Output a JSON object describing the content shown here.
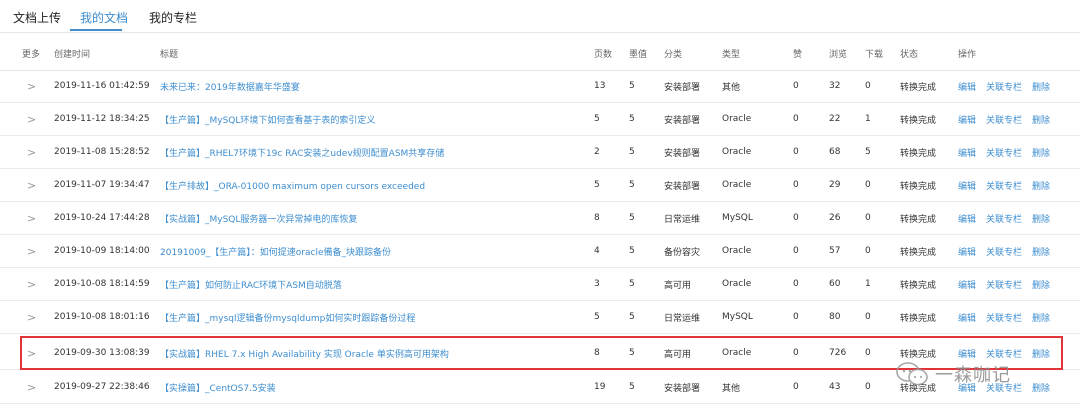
{
  "tabs": [
    {
      "label": "文档上传"
    },
    {
      "label": "我的文档"
    },
    {
      "label": "我的专栏"
    }
  ],
  "table": {
    "headers": {
      "more": "更多",
      "time": "创建时间",
      "title": "标题",
      "pages": "页数",
      "coins": "墨值",
      "category": "分类",
      "type": "类型",
      "likes": "赞",
      "views": "浏览",
      "downloads": "下载",
      "status": "状态",
      "ops": "操作"
    },
    "rows": [
      {
        "time": "2019-11-16 01:42:59",
        "title": "未来已来：2019年数据嘉年华盛宴",
        "pages": "13",
        "coins": "5",
        "category": "安装部署",
        "type": "其他",
        "likes": "0",
        "views": "32",
        "downloads": "0",
        "status": "转换完成"
      },
      {
        "time": "2019-11-12 18:34:25",
        "title": "【生产篇】_MySQL环境下如何查看基于表的索引定义",
        "pages": "5",
        "coins": "5",
        "category": "安装部署",
        "type": "Oracle",
        "likes": "0",
        "views": "22",
        "downloads": "1",
        "status": "转换完成"
      },
      {
        "time": "2019-11-08 15:28:52",
        "title": "【生产篇】_RHEL7环境下19c RAC安装之udev规则配置ASM共享存储",
        "pages": "2",
        "coins": "5",
        "category": "安装部署",
        "type": "Oracle",
        "likes": "0",
        "views": "68",
        "downloads": "5",
        "status": "转换完成"
      },
      {
        "time": "2019-11-07 19:34:47",
        "title": "【生产排故】_ORA-01000 maximum open cursors exceeded",
        "pages": "5",
        "coins": "5",
        "category": "安装部署",
        "type": "Oracle",
        "likes": "0",
        "views": "29",
        "downloads": "0",
        "status": "转换完成"
      },
      {
        "time": "2019-10-24 17:44:28",
        "title": "【实战篇】_MySQL服务器一次异常掉电的库恢复",
        "pages": "8",
        "coins": "5",
        "category": "日常运维",
        "type": "MySQL",
        "likes": "0",
        "views": "26",
        "downloads": "0",
        "status": "转换完成"
      },
      {
        "time": "2019-10-09 18:14:00",
        "title": "20191009_【生产篇】：如何提速oracle備备_块跟踪备份",
        "pages": "4",
        "coins": "5",
        "category": "备份容灾",
        "type": "Oracle",
        "likes": "0",
        "views": "57",
        "downloads": "0",
        "status": "转换完成"
      },
      {
        "time": "2019-10-08 18:14:59",
        "title": "【生产篇】如何防止RAC环境下ASM自动脱落",
        "pages": "3",
        "coins": "5",
        "category": "高可用",
        "type": "Oracle",
        "likes": "0",
        "views": "60",
        "downloads": "1",
        "status": "转换完成"
      },
      {
        "time": "2019-10-08 18:01:16",
        "title": "【生产篇】_mysql逻辑备份mysqldump如何实时跟踪备份过程",
        "pages": "5",
        "coins": "5",
        "category": "日常运维",
        "type": "MySQL",
        "likes": "0",
        "views": "80",
        "downloads": "0",
        "status": "转换完成"
      },
      {
        "time": "2019-09-30 13:08:39",
        "title": "【实战篇】RHEL 7.x High Availability 实现 Oracle 单实例高可用架构",
        "pages": "8",
        "coins": "5",
        "category": "高可用",
        "type": "Oracle",
        "likes": "0",
        "views": "726",
        "downloads": "0",
        "status": "转换完成"
      },
      {
        "time": "2019-09-27 22:38:46",
        "title": "【实操篇】_CentOS7.5安装",
        "pages": "19",
        "coins": "5",
        "category": "安装部署",
        "type": "其他",
        "likes": "0",
        "views": "43",
        "downloads": "0",
        "status": "转换完成"
      }
    ],
    "ops": {
      "edit": "编辑",
      "link_column": "关联专栏",
      "delete": "删除"
    }
  },
  "watermark": {
    "text": "一森咖记"
  },
  "colors": {
    "accent": "#3e8ed0",
    "highlight": "#e0333a"
  }
}
